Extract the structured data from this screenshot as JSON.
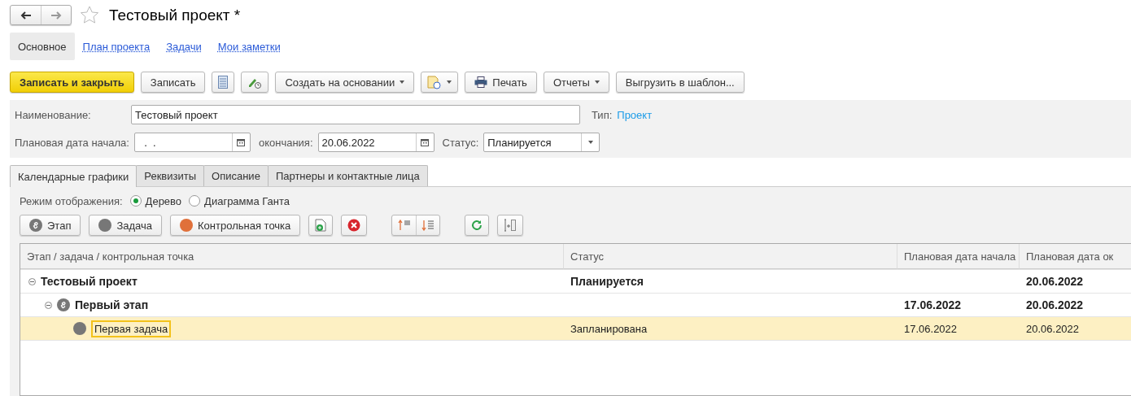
{
  "window": {
    "title": "Тестовый проект *"
  },
  "sections": [
    {
      "label": "Основное",
      "selected": true
    },
    {
      "label": "План проекта",
      "selected": false
    },
    {
      "label": "Задачи",
      "selected": false
    },
    {
      "label": "Мои заметки",
      "selected": false
    }
  ],
  "toolbar": {
    "save_close": "Записать и закрыть",
    "save": "Записать",
    "create_based_on": "Создать на основании",
    "print": "Печать",
    "reports": "Отчеты",
    "export": "Выгрузить в шаблон..."
  },
  "form": {
    "name_label": "Наименование:",
    "name_value": "Тестовый проект",
    "type_label": "Тип:",
    "type_value": "Проект",
    "start_label": "Плановая дата начала:",
    "start_value": "  .  .",
    "end_label": "окончания:",
    "end_value": "20.06.2022",
    "status_label": "Статус:",
    "status_value": "Планируется"
  },
  "tabs": [
    {
      "label": "Календарные графики",
      "selected": true
    },
    {
      "label": "Реквизиты",
      "selected": false
    },
    {
      "label": "Описание",
      "selected": false
    },
    {
      "label": "Партнеры и контактные лица",
      "selected": false
    }
  ],
  "display_mode": {
    "label": "Режим отображения:",
    "options": [
      {
        "label": "Дерево",
        "selected": true
      },
      {
        "label": "Диаграмма Ганта",
        "selected": false
      }
    ]
  },
  "tree_toolbar": {
    "stage": "Этап",
    "task": "Задача",
    "milestone": "Контрольная точка"
  },
  "table": {
    "columns": [
      "Этап / задача / контрольная точка",
      "Статус",
      "Плановая дата начала",
      "Плановая дата ок"
    ],
    "rows": [
      {
        "kind": "project",
        "name": "Тестовый проект",
        "status": "Планируется",
        "end": "20.06.2022",
        "expanded": true,
        "selected": false,
        "children": [
          {
            "kind": "stage",
            "name": "Первый этап",
            "start": "17.06.2022",
            "end": "20.06.2022",
            "expanded": true,
            "selected": false,
            "children": [
              {
                "kind": "task",
                "name": "Первая задача",
                "status": "Запланирована",
                "start": "17.06.2022",
                "end": "20.06.2022",
                "selected": true
              }
            ]
          }
        ]
      }
    ]
  }
}
